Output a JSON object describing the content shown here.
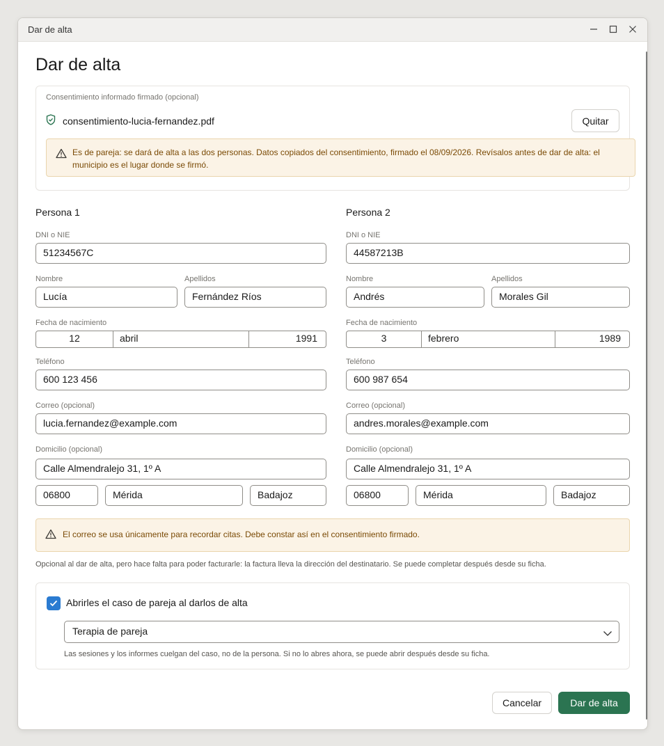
{
  "window": {
    "title": "Dar de alta"
  },
  "heading": "Dar de alta",
  "consent": {
    "label": "Consentimiento informado firmado (opcional)",
    "file_name": "consentimiento-lucia-fernandez.pdf",
    "remove_label": "Quitar",
    "warning": "Es de pareja: se dará de alta a las dos personas. Datos copiados del consentimiento, firmado el 08/09/2026. Revísalos antes de dar de alta: el municipio es el lugar donde se firmó."
  },
  "labels": {
    "dni": "DNI o NIE",
    "nombre": "Nombre",
    "apellidos": "Apellidos",
    "fecha": "Fecha de nacimiento",
    "telefono": "Teléfono",
    "correo": "Correo (opcional)",
    "domicilio": "Domicilio (opcional)"
  },
  "persons": [
    {
      "title": "Persona 1",
      "dni": "51234567C",
      "nombre": "Lucía",
      "apellidos": "Fernández Ríos",
      "birth_day": "12",
      "birth_month": "abril",
      "birth_year": "1991",
      "telefono": "600 123 456",
      "correo": "lucia.fernandez@example.com",
      "direccion": "Calle Almendralejo 31, 1º A",
      "cp": "06800",
      "municipio": "Mérida",
      "provincia": "Badajoz"
    },
    {
      "title": "Persona 2",
      "dni": "44587213B",
      "nombre": "Andrés",
      "apellidos": "Morales Gil",
      "birth_day": "3",
      "birth_month": "febrero",
      "birth_year": "1989",
      "telefono": "600 987 654",
      "correo": "andres.morales@example.com",
      "direccion": "Calle Almendralejo 31, 1º A",
      "cp": "06800",
      "municipio": "Mérida",
      "provincia": "Badajoz"
    }
  ],
  "email_warning": "El correo se usa únicamente para recordar citas. Debe constar así en el consentimiento firmado.",
  "address_note": "Opcional al dar de alta, pero hace falta para poder facturarle: la factura lleva la dirección del destinatario. Se puede completar después desde su ficha.",
  "case": {
    "checked": true,
    "checkbox_label": "Abrirles el caso de pareja al darlos de alta",
    "selected": "Terapia de pareja",
    "note": "Las sesiones y los informes cuelgan del caso, no de la persona. Si no lo abres ahora, se puede abrir después desde su ficha."
  },
  "footer": {
    "cancel": "Cancelar",
    "submit": "Dar de alta"
  },
  "colors": {
    "accent": "#2b7451",
    "checkbox": "#2a7bd1",
    "warning_bg": "#fbf3e6",
    "warning_text": "#7a4a05",
    "shield": "#2b7451"
  }
}
